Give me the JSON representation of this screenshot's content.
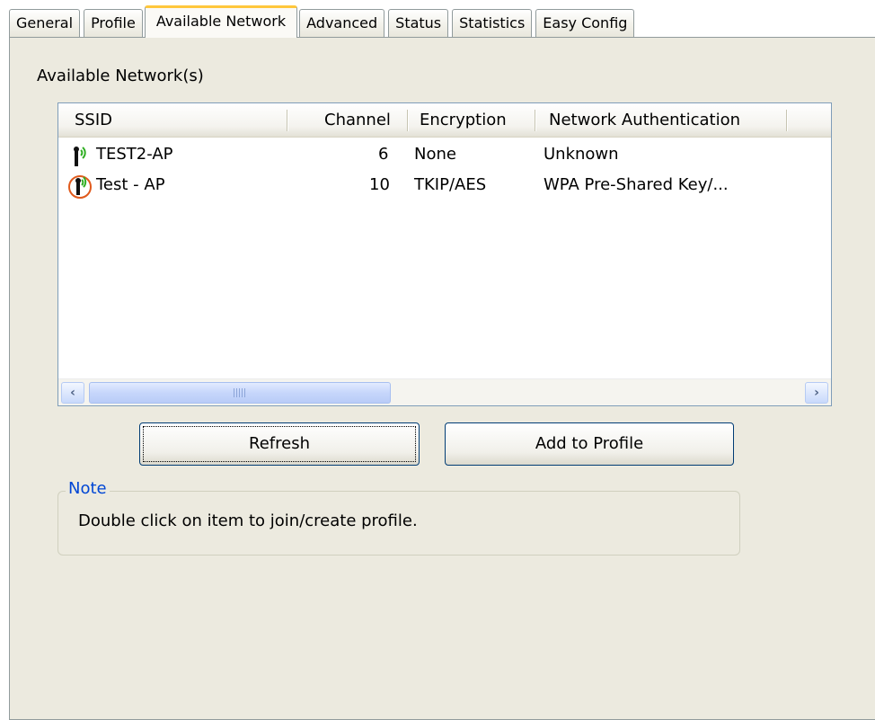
{
  "tabs": [
    {
      "label": "General"
    },
    {
      "label": "Profile"
    },
    {
      "label": "Available Network",
      "active": true
    },
    {
      "label": "Advanced"
    },
    {
      "label": "Status"
    },
    {
      "label": "Statistics"
    },
    {
      "label": "Easy Config"
    }
  ],
  "section_label": "Available Network(s)",
  "list": {
    "columns": {
      "ssid": "SSID",
      "channel": "Channel",
      "encryption": "Encryption",
      "auth": "Network Authentication"
    },
    "rows": [
      {
        "ssid": "TEST2-AP",
        "channel": "6",
        "encryption": "None",
        "auth": "Unknown",
        "icon": "wifi-signal-icon"
      },
      {
        "ssid": "Test - AP",
        "channel": "10",
        "encryption": "TKIP/AES",
        "auth": "WPA Pre-Shared Key/...",
        "icon": "wifi-connected-icon"
      }
    ]
  },
  "buttons": {
    "refresh": "Refresh",
    "add_to_profile": "Add to Profile"
  },
  "note": {
    "title": "Note",
    "text": "Double click on item to join/create profile."
  },
  "colors": {
    "active_tab_accent": "#ffc73c",
    "panel_bg": "#eceadf",
    "note_title": "#0046d5",
    "signal_green": "#2fae22",
    "connected_ring": "#e05a1c"
  }
}
